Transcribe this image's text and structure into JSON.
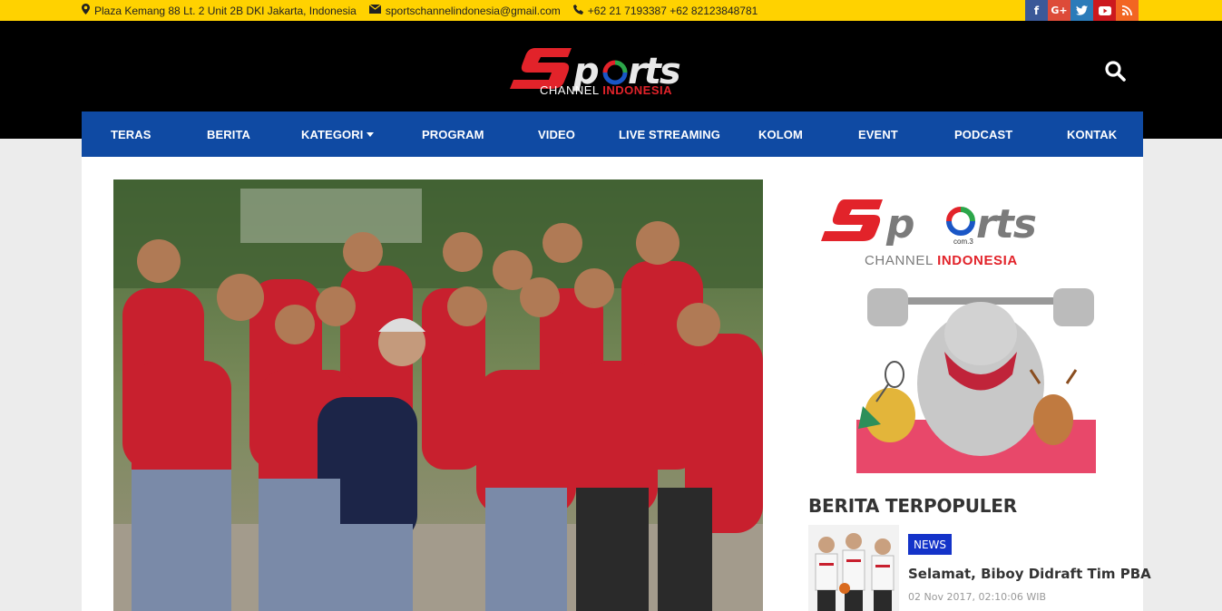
{
  "topbar": {
    "address": "Plaza Kemang 88 Lt. 2 Unit 2B DKI Jakarta, Indonesia",
    "email": "sportschannelindonesia@gmail.com",
    "phone": "+62 21 7193387 +62 82123848781",
    "address_icon": "map-marker-icon",
    "email_icon": "envelope-icon",
    "phone_icon": "phone-icon"
  },
  "social": [
    {
      "name": "facebook",
      "glyph": "f",
      "color": "#3b5998"
    },
    {
      "name": "google-plus",
      "glyph": "G+",
      "color": "#dd4b39"
    },
    {
      "name": "twitter",
      "glyph": "t",
      "color": "#2b7bb9"
    },
    {
      "name": "youtube",
      "glyph": "▶",
      "color": "#cc181e"
    },
    {
      "name": "rss",
      "glyph": "◉",
      "color": "#f26522"
    }
  ],
  "logo": {
    "word": "Sports",
    "line2a": "CHANNEL",
    "line2b": "INDONESIA",
    "sub": "com.3"
  },
  "nav": {
    "items": [
      "TERAS",
      "BERITA",
      "KATEGORI",
      "PROGRAM",
      "VIDEO",
      "LIVE STREAMING",
      "KOLOM",
      "EVENT",
      "PODCAST",
      "KONTAK"
    ]
  },
  "sidebar": {
    "popular_title": "BERITA TERPOPULER",
    "news": {
      "badge": "NEWS",
      "title": "Selamat, Biboy Didraft Tim PBA",
      "date": "02 Nov 2017, 02:10:06 WIB"
    }
  },
  "colors": {
    "topbar": "#ffd200",
    "header": "#000000",
    "nav": "#0f4aa3",
    "logo_red": "#e2232a",
    "badge": "#1433c9"
  }
}
